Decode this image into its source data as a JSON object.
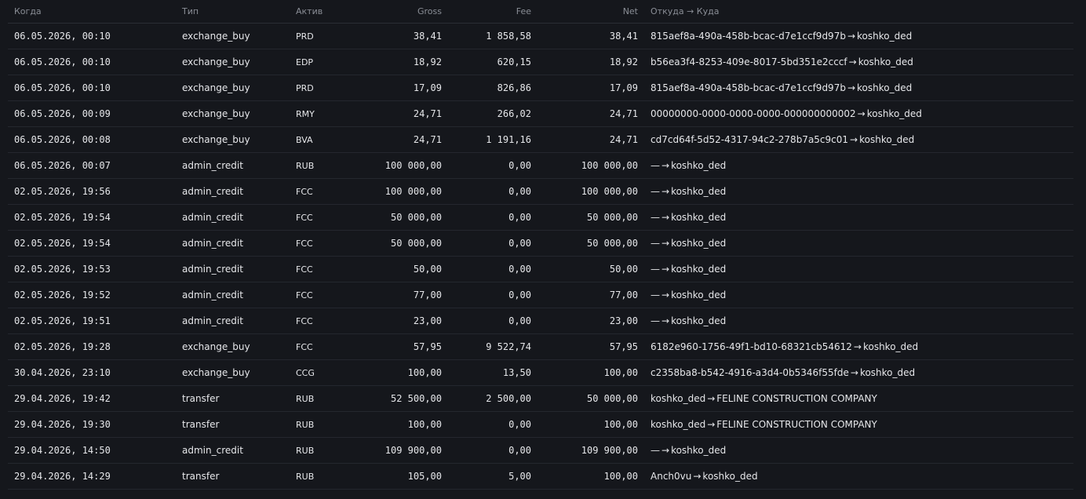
{
  "columns": {
    "when": "Когда",
    "type": "Тип",
    "asset": "Актив",
    "gross": "Gross",
    "fee": "Fee",
    "net": "Net",
    "route": "Откуда → Куда"
  },
  "rows": [
    {
      "when": "06.05.2026, 00:10",
      "type": "exchange_buy",
      "asset": "PRD",
      "gross": "38,41",
      "fee": "1 858,58",
      "net": "38,41",
      "from": "815aef8a-490a-458b-bcac-d7e1ccf9d97b",
      "to": "koshko_ded"
    },
    {
      "when": "06.05.2026, 00:10",
      "type": "exchange_buy",
      "asset": "EDP",
      "gross": "18,92",
      "fee": "620,15",
      "net": "18,92",
      "from": "b56ea3f4-8253-409e-8017-5bd351e2cccf",
      "to": "koshko_ded"
    },
    {
      "when": "06.05.2026, 00:10",
      "type": "exchange_buy",
      "asset": "PRD",
      "gross": "17,09",
      "fee": "826,86",
      "net": "17,09",
      "from": "815aef8a-490a-458b-bcac-d7e1ccf9d97b",
      "to": "koshko_ded"
    },
    {
      "when": "06.05.2026, 00:09",
      "type": "exchange_buy",
      "asset": "RMY",
      "gross": "24,71",
      "fee": "266,02",
      "net": "24,71",
      "from": "00000000-0000-0000-0000-000000000002",
      "to": "koshko_ded"
    },
    {
      "when": "06.05.2026, 00:08",
      "type": "exchange_buy",
      "asset": "BVA",
      "gross": "24,71",
      "fee": "1 191,16",
      "net": "24,71",
      "from": "cd7cd64f-5d52-4317-94c2-278b7a5c9c01",
      "to": "koshko_ded"
    },
    {
      "when": "06.05.2026, 00:07",
      "type": "admin_credit",
      "asset": "RUB",
      "gross": "100 000,00",
      "fee": "0,00",
      "net": "100 000,00",
      "from": "—",
      "to": "koshko_ded"
    },
    {
      "when": "02.05.2026, 19:56",
      "type": "admin_credit",
      "asset": "FCC",
      "gross": "100 000,00",
      "fee": "0,00",
      "net": "100 000,00",
      "from": "—",
      "to": "koshko_ded"
    },
    {
      "when": "02.05.2026, 19:54",
      "type": "admin_credit",
      "asset": "FCC",
      "gross": "50 000,00",
      "fee": "0,00",
      "net": "50 000,00",
      "from": "—",
      "to": "koshko_ded"
    },
    {
      "when": "02.05.2026, 19:54",
      "type": "admin_credit",
      "asset": "FCC",
      "gross": "50 000,00",
      "fee": "0,00",
      "net": "50 000,00",
      "from": "—",
      "to": "koshko_ded"
    },
    {
      "when": "02.05.2026, 19:53",
      "type": "admin_credit",
      "asset": "FCC",
      "gross": "50,00",
      "fee": "0,00",
      "net": "50,00",
      "from": "—",
      "to": "koshko_ded"
    },
    {
      "when": "02.05.2026, 19:52",
      "type": "admin_credit",
      "asset": "FCC",
      "gross": "77,00",
      "fee": "0,00",
      "net": "77,00",
      "from": "—",
      "to": "koshko_ded"
    },
    {
      "when": "02.05.2026, 19:51",
      "type": "admin_credit",
      "asset": "FCC",
      "gross": "23,00",
      "fee": "0,00",
      "net": "23,00",
      "from": "—",
      "to": "koshko_ded"
    },
    {
      "when": "02.05.2026, 19:28",
      "type": "exchange_buy",
      "asset": "FCC",
      "gross": "57,95",
      "fee": "9 522,74",
      "net": "57,95",
      "from": "6182e960-1756-49f1-bd10-68321cb54612",
      "to": "koshko_ded"
    },
    {
      "when": "30.04.2026, 23:10",
      "type": "exchange_buy",
      "asset": "CCG",
      "gross": "100,00",
      "fee": "13,50",
      "net": "100,00",
      "from": "c2358ba8-b542-4916-a3d4-0b5346f55fde",
      "to": "koshko_ded"
    },
    {
      "when": "29.04.2026, 19:42",
      "type": "transfer",
      "asset": "RUB",
      "gross": "52 500,00",
      "fee": "2 500,00",
      "net": "50 000,00",
      "from": "koshko_ded",
      "to": "FELINE CONSTRUCTION COMPANY"
    },
    {
      "when": "29.04.2026, 19:30",
      "type": "transfer",
      "asset": "RUB",
      "gross": "100,00",
      "fee": "0,00",
      "net": "100,00",
      "from": "koshko_ded",
      "to": "FELINE CONSTRUCTION COMPANY"
    },
    {
      "when": "29.04.2026, 14:50",
      "type": "admin_credit",
      "asset": "RUB",
      "gross": "109 900,00",
      "fee": "0,00",
      "net": "109 900,00",
      "from": "—",
      "to": "koshko_ded"
    },
    {
      "when": "29.04.2026, 14:29",
      "type": "transfer",
      "asset": "RUB",
      "gross": "105,00",
      "fee": "5,00",
      "net": "100,00",
      "from": "Anch0vu",
      "to": "koshko_ded"
    }
  ],
  "route_arrow": "→"
}
